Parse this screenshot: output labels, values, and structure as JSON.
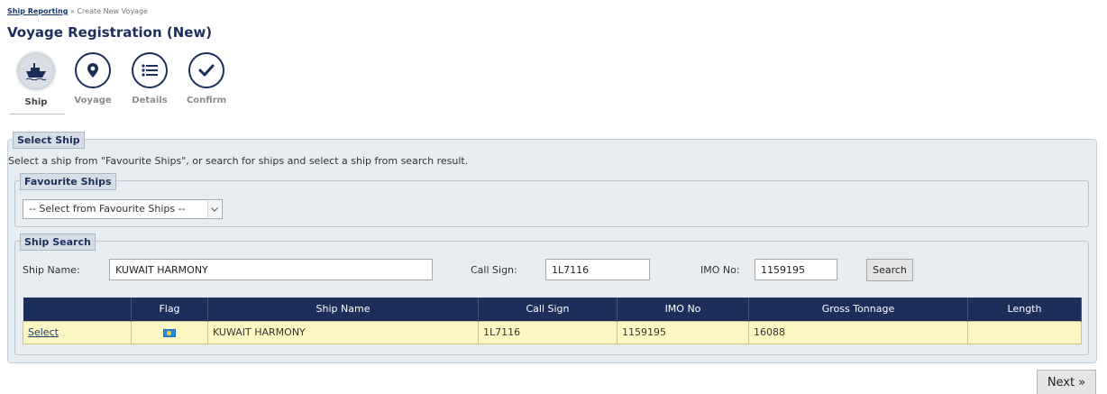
{
  "breadcrumb": {
    "link": "Ship Reporting",
    "separator": "»",
    "current": "Create New Voyage"
  },
  "title": "Voyage Registration (New)",
  "steps": [
    {
      "label": "Ship",
      "icon": "ship-icon",
      "active": true
    },
    {
      "label": "Voyage",
      "icon": "location-pin-icon",
      "active": false
    },
    {
      "label": "Details",
      "icon": "list-icon",
      "active": false
    },
    {
      "label": "Confirm",
      "icon": "checkmark-icon",
      "active": false
    }
  ],
  "select_ship": {
    "legend": "Select Ship",
    "instruction": "Select a ship from \"Favourite Ships\", or search for ships and select a ship from search result."
  },
  "favourites": {
    "legend": "Favourite Ships",
    "select_value": "-- Select from Favourite Ships --"
  },
  "search": {
    "legend": "Ship Search",
    "ship_name_label": "Ship Name:",
    "ship_name_value": "KUWAIT HARMONY",
    "call_sign_label": "Call Sign:",
    "call_sign_value": "1L7116",
    "imo_label": "IMO No:",
    "imo_value": "1159195",
    "button": "Search"
  },
  "table": {
    "columns": [
      "",
      "Flag",
      "Ship Name",
      "Call Sign",
      "IMO No",
      "Gross Tonnage",
      "Length"
    ],
    "rows": [
      {
        "action": "Select",
        "flag": "flag-icon",
        "ship_name": "KUWAIT HARMONY",
        "call_sign": "1L7116",
        "imo": "1159195",
        "gross_tonnage": "16088",
        "length": ""
      }
    ]
  },
  "next_button": "Next »",
  "colors": {
    "navy": "#1c2f5a",
    "row_yellow": "#fdf7c4",
    "panel_bg": "#e7ecf1"
  }
}
